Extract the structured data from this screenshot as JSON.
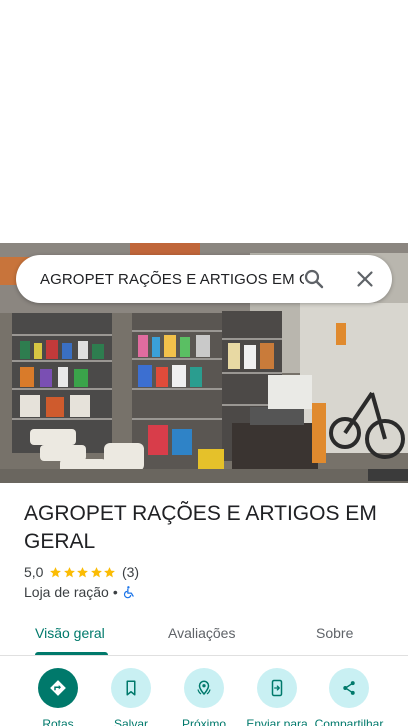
{
  "search": {
    "query": "AGROPET RAÇÕES E ARTIGOS EM GERAL",
    "search_icon": "search-icon",
    "close_icon": "close-icon"
  },
  "place": {
    "name": "AGROPET RAÇÕES E ARTIGOS EM GERAL",
    "rating": "5,0",
    "stars": 5,
    "reviews_count": "(3)",
    "category": "Loja de ração",
    "separator": "•",
    "accessibility_icon": "wheelchair-icon"
  },
  "tabs": [
    {
      "label": "Visão geral",
      "active": true
    },
    {
      "label": "Avaliações",
      "active": false
    },
    {
      "label": "Sobre",
      "active": false
    }
  ],
  "actions": [
    {
      "label": "Rotas",
      "icon": "directions-icon"
    },
    {
      "label": "Salvar",
      "icon": "bookmark-icon"
    },
    {
      "label": "Próximo",
      "icon": "nearby-icon"
    },
    {
      "label": "Enviar para",
      "icon": "send-to-phone-icon"
    },
    {
      "label": "Compartilhar",
      "icon": "share-icon"
    }
  ],
  "colors": {
    "accent": "#00796b",
    "action_bg": "#c9f0f3",
    "star": "#fbbc04",
    "accessibility": "#1a73e8"
  }
}
